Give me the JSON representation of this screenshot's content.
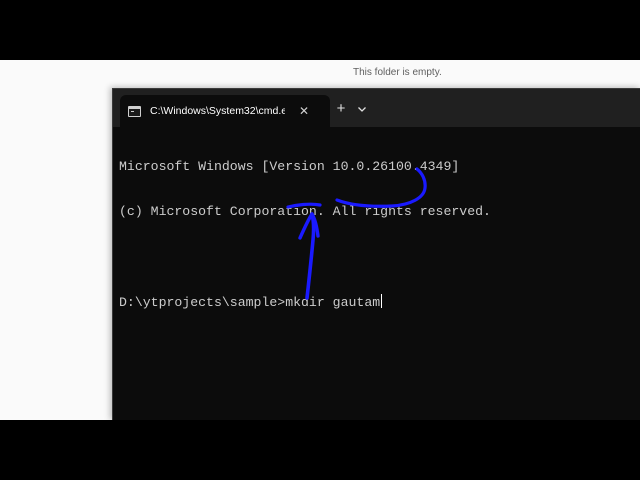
{
  "explorer": {
    "empty_message": "This folder is empty."
  },
  "terminal": {
    "tab_title": "C:\\Windows\\System32\\cmd.e",
    "tab_icon": "cmd-terminal-icon",
    "close_symbol": "✕",
    "new_tab_symbol": "+",
    "dropdown_icon": "chevron-down-icon",
    "lines": [
      "Microsoft Windows [Version 10.0.26100.4349]",
      "(c) Microsoft Corporation. All rights reserved.",
      "",
      "D:\\ytprojects\\sample>mkdir gautam"
    ]
  },
  "colors": {
    "terminal_bg": "#0c0c0c",
    "tabbar_bg": "#202020",
    "console_text": "#cccccc",
    "annotation_ink": "#1a1aff"
  }
}
